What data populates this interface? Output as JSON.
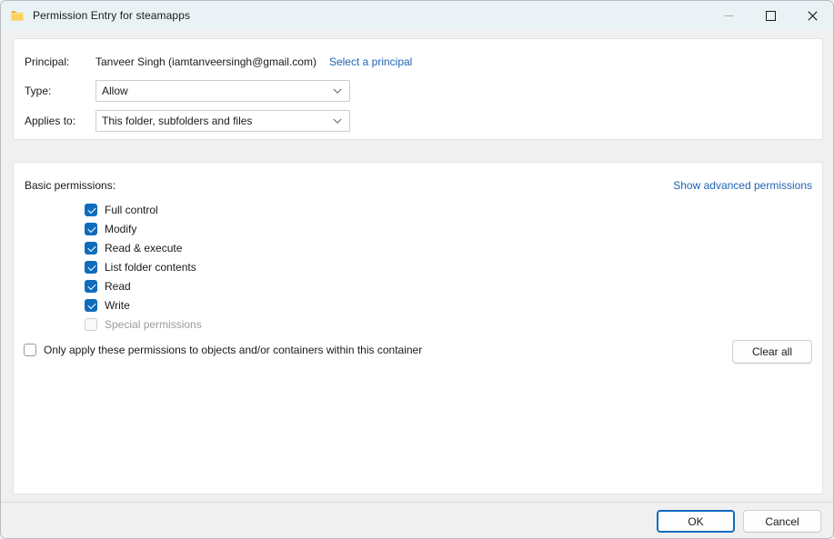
{
  "window": {
    "title": "Permission Entry for steamapps",
    "icon": "folder-icon",
    "caption": {
      "minimize": "minimize-icon",
      "maximize": "maximize-icon",
      "close": "close-icon"
    }
  },
  "principal_section": {
    "principal_label": "Principal:",
    "principal_value": "Tanveer Singh (iamtanveersingh@gmail.com)",
    "select_principal_link": "Select a principal",
    "type_label": "Type:",
    "type_value": "Allow",
    "applies_to_label": "Applies to:",
    "applies_to_value": "This folder, subfolders and files"
  },
  "permissions_section": {
    "heading": "Basic permissions:",
    "advanced_link": "Show advanced permissions",
    "items": [
      {
        "label": "Full control",
        "checked": true,
        "disabled": false
      },
      {
        "label": "Modify",
        "checked": true,
        "disabled": false
      },
      {
        "label": "Read & execute",
        "checked": true,
        "disabled": false
      },
      {
        "label": "List folder contents",
        "checked": true,
        "disabled": false
      },
      {
        "label": "Read",
        "checked": true,
        "disabled": false
      },
      {
        "label": "Write",
        "checked": true,
        "disabled": false
      },
      {
        "label": "Special permissions",
        "checked": false,
        "disabled": true
      }
    ],
    "only_apply_label": "Only apply these permissions to objects and/or containers within this container",
    "only_apply_checked": false,
    "clear_all_label": "Clear all"
  },
  "footer": {
    "ok_label": "OK",
    "cancel_label": "Cancel"
  },
  "colors": {
    "accent": "#0f6cbd",
    "link": "#1f63b5",
    "titlebar": "#eaf2f5",
    "window_bg": "#f0f0f0",
    "panel_bg": "#ffffff",
    "disabled_text": "#9b9b9b"
  }
}
